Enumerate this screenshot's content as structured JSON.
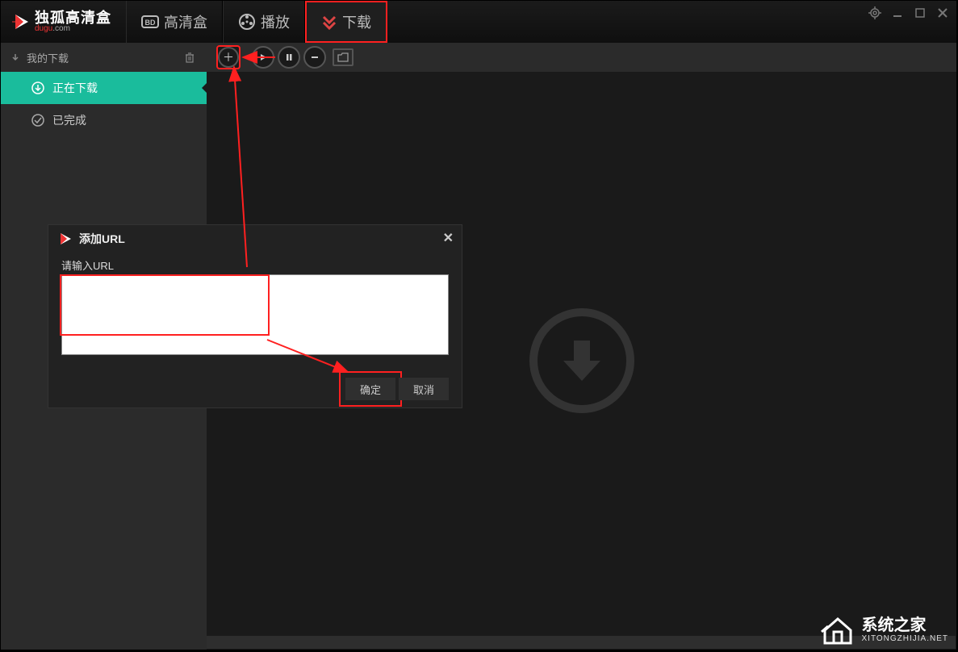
{
  "header": {
    "app_name": "独孤高清盒",
    "brand_prefix": "dugu",
    "brand_suffix": ".com",
    "tabs": [
      {
        "label": "高清盒"
      },
      {
        "label": "播放"
      },
      {
        "label": "下载"
      }
    ]
  },
  "sidebar": {
    "title": "我的下载",
    "items": [
      {
        "label": "正在下载"
      },
      {
        "label": "已完成"
      }
    ]
  },
  "dialog": {
    "title": "添加URL",
    "label": "请输入URL",
    "value": "",
    "ok": "确定",
    "cancel": "取消"
  },
  "watermark": {
    "main": "系统之家",
    "sub": "XITONGZHIJIA.NET"
  }
}
